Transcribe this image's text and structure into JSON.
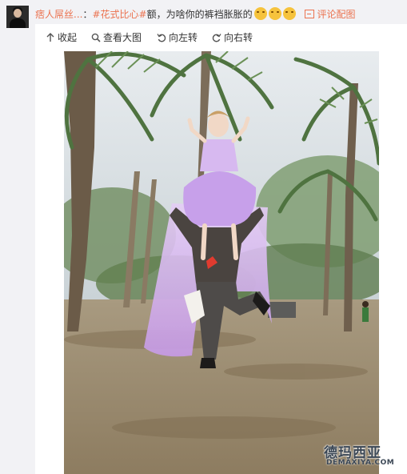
{
  "post": {
    "username": "痞人屌丝...",
    "separator": "：",
    "topic": "#花式比心#",
    "text": "额，为啥你的裤裆胀胀的",
    "emoji_icons": [
      "doge-emoji-icon",
      "doge-emoji-icon",
      "doge-emoji-icon"
    ],
    "comment_with_image": "评论配图"
  },
  "toolbar": {
    "collapse": "收起",
    "view_large": "查看大图",
    "rotate_left": "向左转",
    "rotate_right": "向右转"
  },
  "photo": {
    "description_icons": [
      "palm-tree",
      "purple-dress",
      "grey-suit",
      "heart-patch"
    ]
  },
  "watermark": {
    "chinese": "德玛西亚",
    "english": "DEMAXIYA.COM"
  },
  "colors": {
    "link": "#eb7350",
    "dress": "#c9a6e6",
    "background": "#f2f2f5"
  }
}
